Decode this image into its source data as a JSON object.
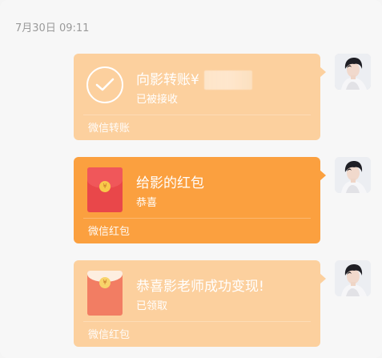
{
  "chat": {
    "timestamp": "7月30日 09:11"
  },
  "messages": [
    {
      "type": "transfer",
      "title": "向影转账¥",
      "subtitle": "已被接收",
      "footer": "微信转账",
      "amount_hidden": true
    },
    {
      "type": "red-packet",
      "title": "给影的红包",
      "subtitle": "恭喜",
      "footer": "微信红包"
    },
    {
      "type": "red-packet-received",
      "title": "恭喜影老师成功变现!",
      "subtitle": "已领取",
      "footer": "微信红包"
    }
  ],
  "colors": {
    "transfer_bg": "#fcd09e",
    "redpacket_bg": "#fba03f",
    "received_bg": "#fcd09e",
    "timestamp_text": "#9a9a9a"
  },
  "icons": {
    "transfer": "check-circle-icon",
    "redpacket": "red-envelope-icon",
    "received": "opened-red-envelope-icon",
    "coin": "yuan-coin-icon"
  }
}
